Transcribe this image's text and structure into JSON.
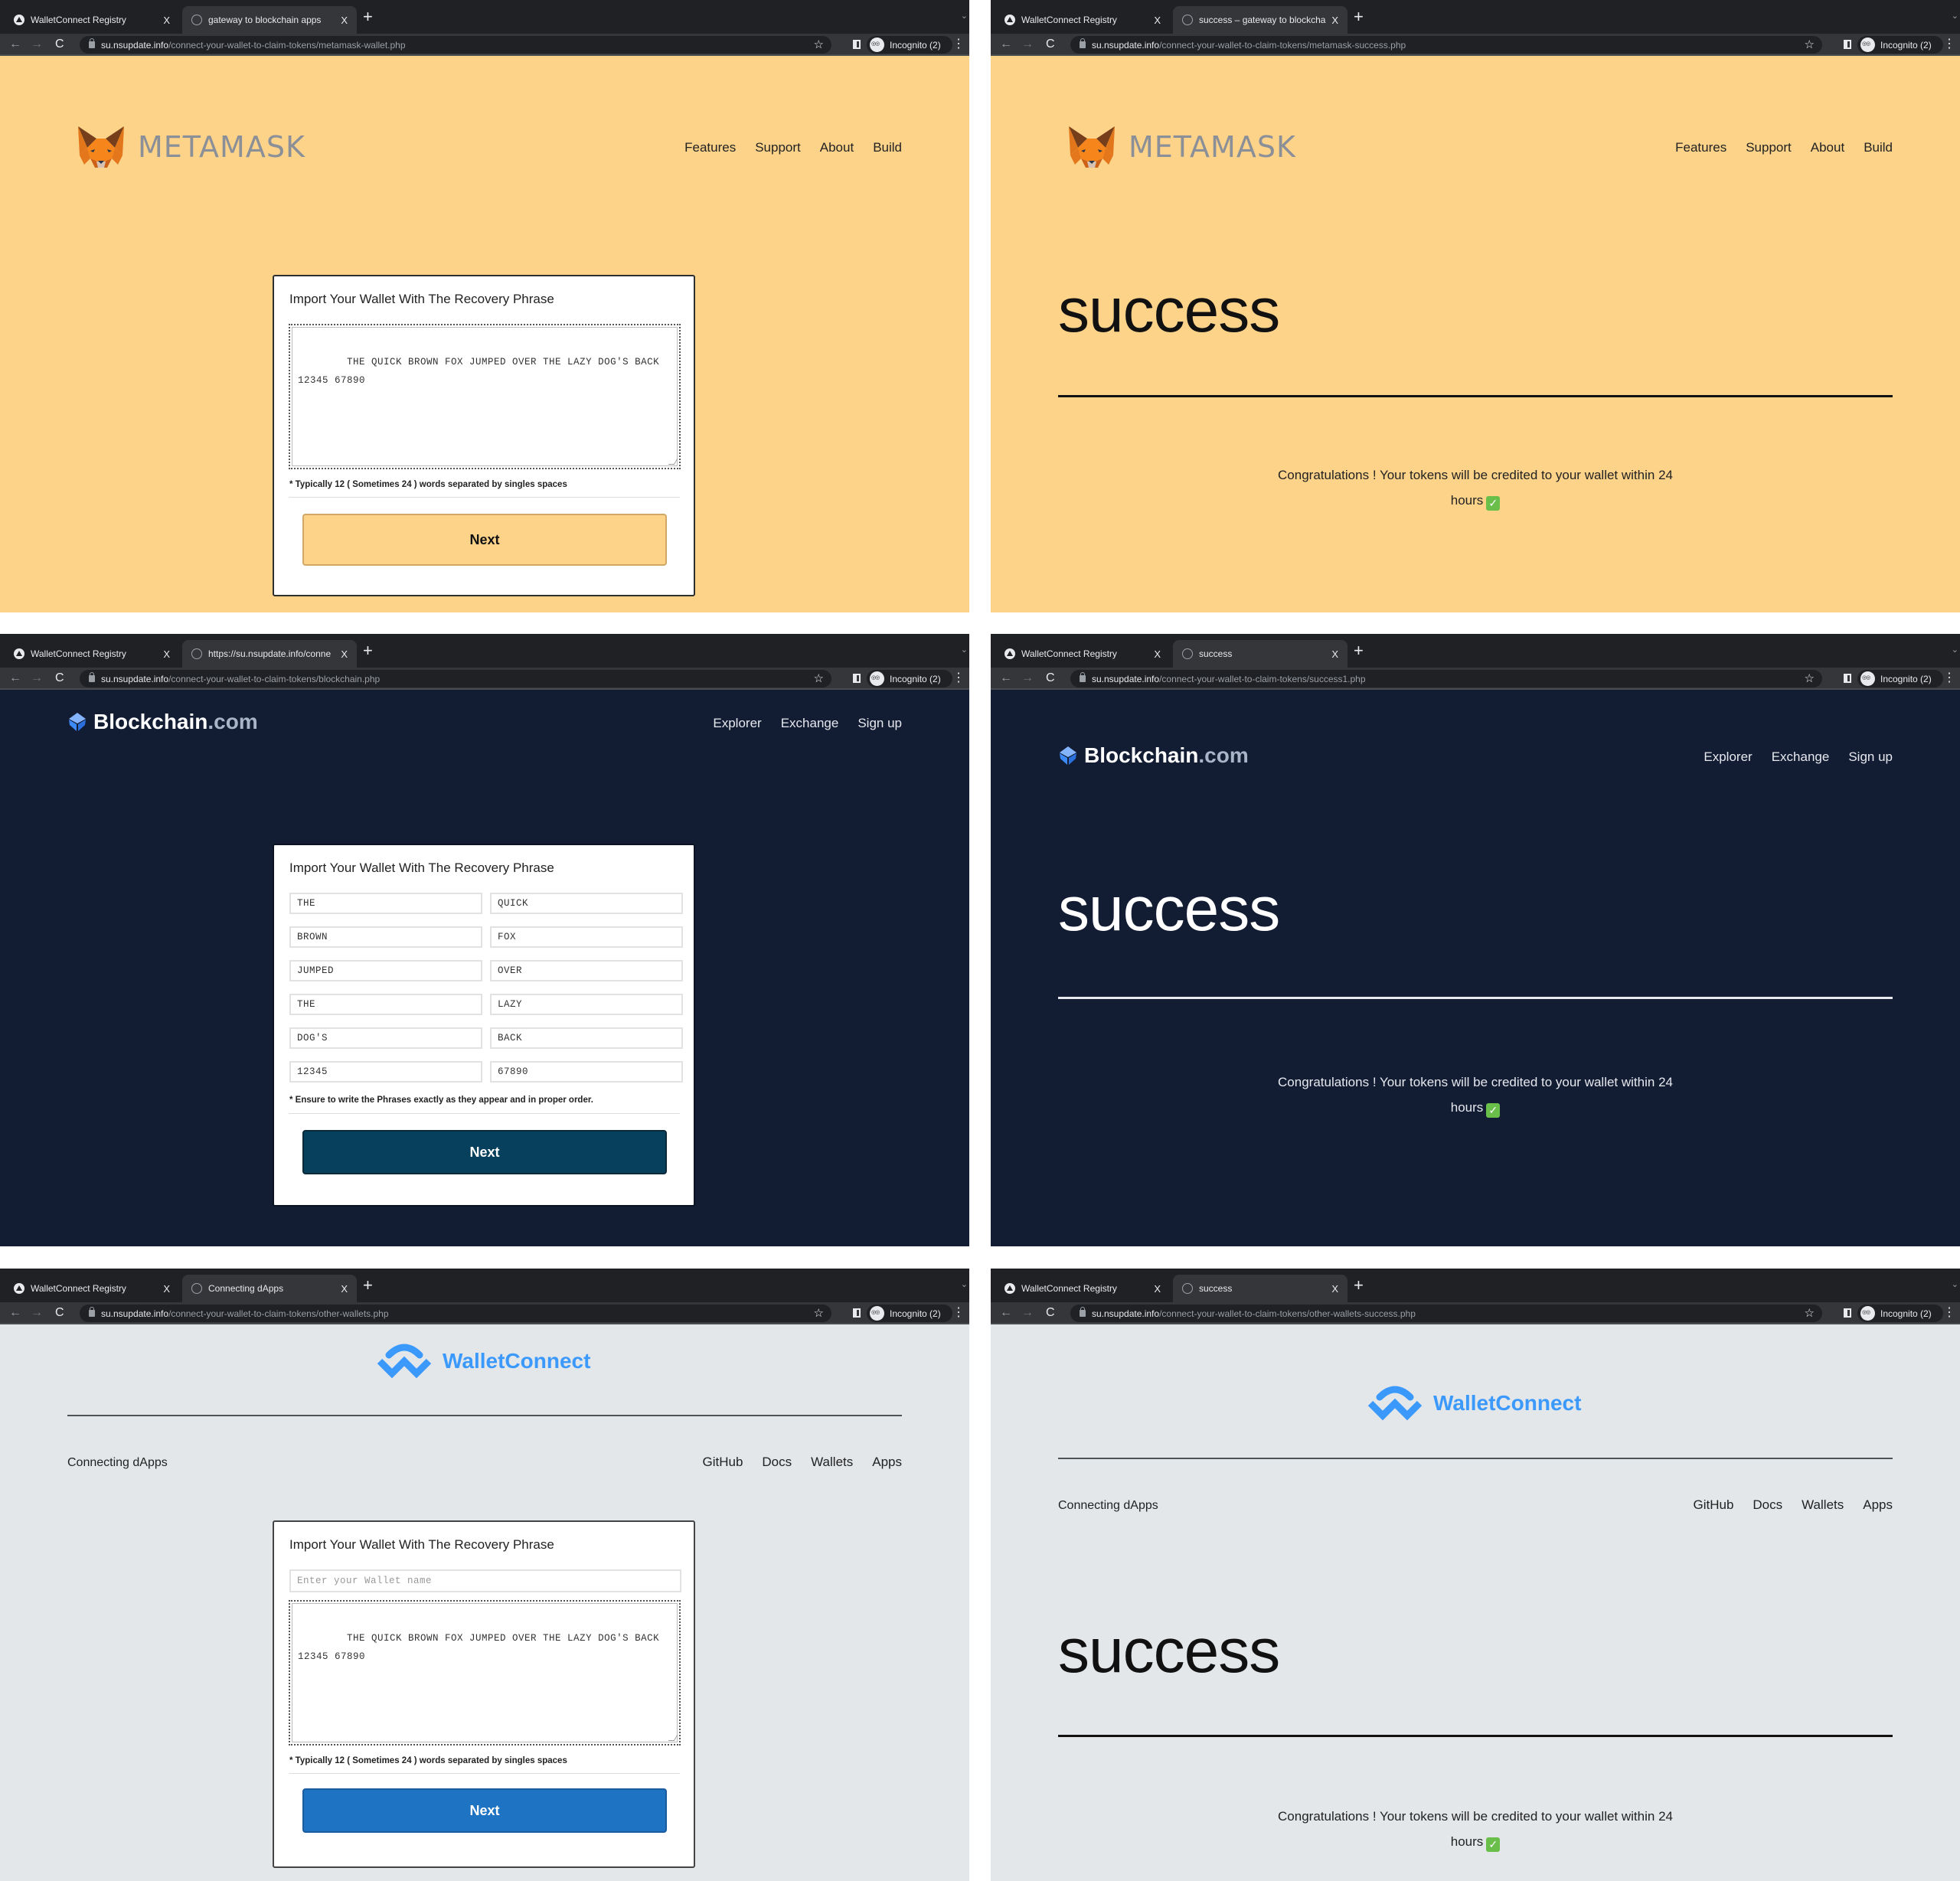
{
  "common": {
    "tab_inactive_label": "WalletConnect Registry",
    "tab_close": "X",
    "new_tab": "+",
    "tab_menu": "⌄",
    "back": "←",
    "forward": "→",
    "reload": "C",
    "url_host": "su.nsupdate.info",
    "star": "☆",
    "incognito_label": "Incognito (2)",
    "menu": "⋮",
    "form_title": "Import Your Wallet With The Recovery Phrase",
    "next_label": "Next",
    "success_heading": "success",
    "congrats_line1": "Congratulations ! Your tokens will be credited to your wallet within 24",
    "congrats_line2": "hours",
    "check_glyph": "✓"
  },
  "panels": {
    "metamask_form": {
      "tab_active_label": "gateway to blockchain apps",
      "url_path": "/connect-your-wallet-to-claim-tokens/metamask-wallet.php",
      "logo_text": "METAMASK",
      "nav": [
        "Features",
        "Support",
        "About",
        "Build"
      ],
      "phrase_value": "THE QUICK BROWN FOX JUMPED OVER THE LAZY DOG'S BACK 12345 67890",
      "hint": "* Typically 12 ( Sometimes 24 ) words separated by singles spaces"
    },
    "metamask_success": {
      "tab_active_label": "success – gateway to blockcha",
      "url_path": "/connect-your-wallet-to-claim-tokens/metamask-success.php",
      "logo_text": "METAMASK",
      "nav": [
        "Features",
        "Support",
        "About",
        "Build"
      ]
    },
    "blockchain_form": {
      "tab_active_label": "https://su.nsupdate.info/conne",
      "url_path": "/connect-your-wallet-to-claim-tokens/blockchain.php",
      "logo_main": "Blockchain",
      "logo_suffix": ".com",
      "nav": [
        "Explorer",
        "Exchange",
        "Sign up"
      ],
      "words": [
        "THE",
        "QUICK",
        "BROWN",
        "FOX",
        "JUMPED",
        "OVER",
        "THE",
        "LAZY",
        "DOG'S",
        "BACK",
        "12345",
        "67890"
      ],
      "hint": "* Ensure to write the Phrases exactly as they appear and in proper order."
    },
    "blockchain_success": {
      "tab_active_label": "success",
      "url_path": "/connect-your-wallet-to-claim-tokens/success1.php",
      "logo_main": "Blockchain",
      "logo_suffix": ".com",
      "nav": [
        "Explorer",
        "Exchange",
        "Sign up"
      ]
    },
    "walletconnect_form": {
      "tab_active_label": "Connecting dApps",
      "url_path": "/connect-your-wallet-to-claim-tokens/other-wallets.php",
      "logo_text": "WalletConnect",
      "subtitle": "Connecting dApps",
      "nav": [
        "GitHub",
        "Docs",
        "Wallets",
        "Apps"
      ],
      "wallet_name_placeholder": "Enter your Wallet name",
      "phrase_value": "THE QUICK BROWN FOX JUMPED OVER THE LAZY DOG'S BACK 12345 67890",
      "hint": "* Typically 12 ( Sometimes 24 ) words separated by singles spaces"
    },
    "walletconnect_success": {
      "tab_active_label": "success",
      "url_path": "/connect-your-wallet-to-claim-tokens/other-wallets-success.php",
      "logo_text": "WalletConnect",
      "subtitle": "Connecting dApps",
      "nav": [
        "GitHub",
        "Docs",
        "Wallets",
        "Apps"
      ]
    }
  },
  "colors": {
    "metamask_bg": "#fdd38a",
    "blockchain_bg": "#121c33",
    "walletconnect_bg": "#e3e7ea",
    "walletconnect_blue": "#3b99fc",
    "blockchain_button": "#07405c",
    "walletconnect_button": "#1f73c3",
    "success_check": "#6abf4b"
  }
}
